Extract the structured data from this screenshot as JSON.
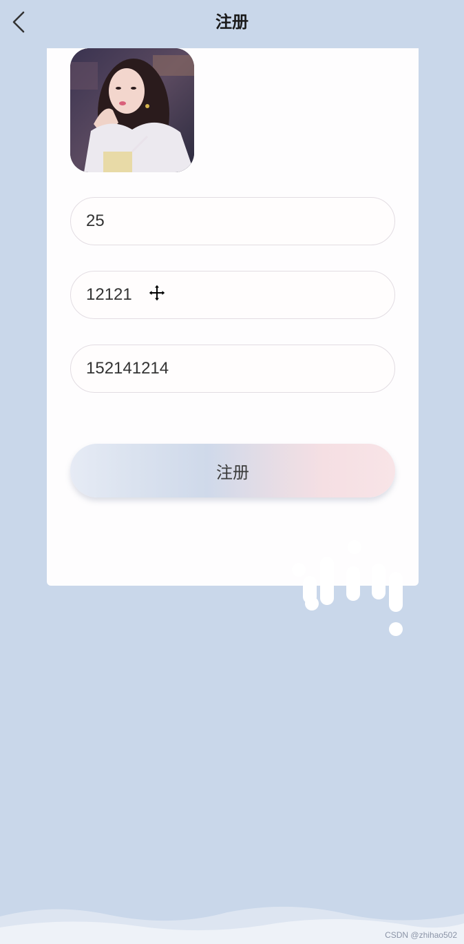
{
  "header": {
    "title": "注册",
    "back_icon": "chevron-left-icon"
  },
  "form": {
    "fields": [
      {
        "value": "25"
      },
      {
        "value": "12121"
      },
      {
        "value": "152141214"
      }
    ],
    "submit_label": "注册"
  },
  "colors": {
    "background": "#c9d7ea",
    "card": "#fefdfe",
    "button_gradient_start": "#e6ebf5",
    "button_gradient_mid": "#cfd9ea",
    "button_gradient_end": "#f8e4e7"
  },
  "footer": {
    "watermark": "CSDN @zhihao502"
  }
}
